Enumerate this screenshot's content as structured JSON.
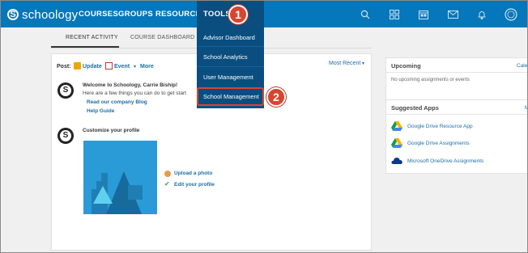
{
  "header": {
    "logo_mark": "S",
    "logo_text": "schoology",
    "nav": [
      "COURSES",
      "GROUPS",
      "RESOURCES",
      "TOOLS"
    ]
  },
  "icons": [
    "search-icon",
    "grid-icon",
    "calendar-icon",
    "mail-icon",
    "bell-icon",
    "profile-icon"
  ],
  "tabs": {
    "recent": "RECENT ACTIVITY",
    "dashboard": "COURSE DASHBOARD"
  },
  "post": {
    "label": "Post:",
    "update": "Update",
    "event": "Event",
    "more": "More",
    "sort": "Most Recent"
  },
  "welcome": {
    "title": "Welcome to Schoology, Carrie Biship!",
    "line": "Here are a few things you can do to get start",
    "link1": "Read our company Blog",
    "link2": "Help Guide"
  },
  "profile": {
    "title": "Customize your profile",
    "upload": "Upload a photo",
    "edit": "Edit your profile"
  },
  "upcoming": {
    "title": "Upcoming",
    "cut_link": "Cale",
    "empty": "No upcoming assignments or events"
  },
  "apps": {
    "title": "Suggested Apps",
    "cut_link": "M",
    "items": [
      "Google Drive Resource App",
      "Google Drive Assignments",
      "Microsoft OneDrive Assignments"
    ]
  },
  "tools_menu": [
    "Advisor Dashboard",
    "School Analytics",
    "User Management",
    "School Management"
  ],
  "badges": [
    "1",
    "2"
  ],
  "colors": {
    "brand": "#0677ba",
    "menu": "#0a4e7f",
    "callout": "#d8452f"
  }
}
